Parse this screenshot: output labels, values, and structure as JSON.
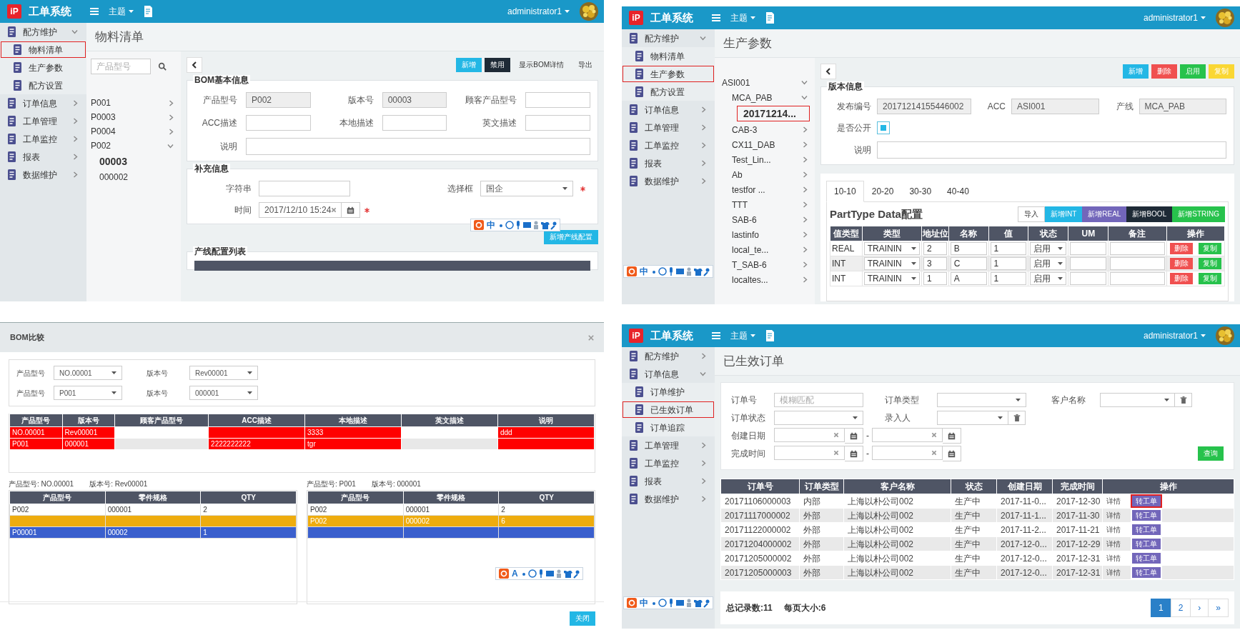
{
  "bom_list": {
    "app": {
      "logo": "iP",
      "title": "工单系统",
      "theme_menu": "主题",
      "user": "administrator1"
    },
    "sidebar": [
      {
        "label": "配方维护",
        "selected": false,
        "expanded": true,
        "children": [
          {
            "label": "物料清单",
            "selected": true
          },
          {
            "label": "生产参数",
            "selected": false
          },
          {
            "label": "配方设置",
            "selected": false
          }
        ]
      },
      {
        "label": "订单信息",
        "selected": false,
        "expanded": false
      },
      {
        "label": "工单管理",
        "selected": false,
        "expanded": false
      },
      {
        "label": "工单监控",
        "selected": false,
        "expanded": false
      },
      {
        "label": "报表",
        "selected": false,
        "expanded": false
      },
      {
        "label": "数据维护",
        "selected": false,
        "expanded": false
      }
    ],
    "page_title": "物料清单",
    "search": {
      "placeholder": "产品型号"
    },
    "tree": [
      {
        "label": "P001",
        "expanded": false
      },
      {
        "label": "P0003",
        "expanded": false
      },
      {
        "label": "P0004",
        "expanded": false
      },
      {
        "label": "P002",
        "expanded": true,
        "children": [
          {
            "label": "00003",
            "selected": true
          },
          {
            "label": "000002",
            "selected": false
          }
        ]
      }
    ],
    "buttons": [
      {
        "label": "新增",
        "kind": "info"
      },
      {
        "label": "禁用",
        "kind": "dark"
      },
      {
        "label": "显示BOM详情",
        "kind": "link"
      },
      {
        "label": "导出",
        "kind": "link"
      }
    ],
    "basic_info": {
      "legend": "BOM基本信息",
      "fields": [
        {
          "label": "产品型号",
          "value": "P002",
          "readonly": true
        },
        {
          "label": "版本号",
          "value": "00003",
          "readonly": true
        },
        {
          "label": "顾客产品型号",
          "readonly": false
        },
        {
          "label": "ACC描述",
          "readonly": false
        },
        {
          "label": "本地描述",
          "readonly": false
        },
        {
          "label": "英文描述",
          "readonly": false
        }
      ],
      "note": {
        "label": "说明"
      }
    },
    "extra_info": {
      "legend": "补充信息",
      "text_field": {
        "label": "字符串"
      },
      "select_field": {
        "label": "选择框",
        "value": "国企",
        "required": true
      },
      "time_field": {
        "label": "时间",
        "value": "2017/12/10 15:24",
        "required": true
      }
    },
    "add_line_button": "新增产线配置",
    "line_config": {
      "legend": "产线配置列表"
    },
    "ime": {
      "mode": "中"
    }
  },
  "production_params": {
    "app": {
      "logo": "iP",
      "title": "工单系统",
      "theme_menu": "主题",
      "user": "administrator1"
    },
    "sidebar": [
      {
        "label": "配方维护",
        "selected": false,
        "expanded": true,
        "children": [
          {
            "label": "物料清单",
            "selected": false
          },
          {
            "label": "生产参数",
            "selected": true
          },
          {
            "label": "配方设置",
            "selected": false
          }
        ]
      },
      {
        "label": "订单信息",
        "selected": false,
        "expanded": false
      },
      {
        "label": "工单管理",
        "selected": false,
        "expanded": false
      },
      {
        "label": "工单监控",
        "selected": false,
        "expanded": false
      },
      {
        "label": "报表",
        "selected": false,
        "expanded": false
      },
      {
        "label": "数据维护",
        "selected": false,
        "expanded": false
      }
    ],
    "page_title": "生产参数",
    "tree": [
      {
        "label": "ASI001",
        "expanded": true,
        "children": [
          {
            "label": "MCA_PAB",
            "expanded": true,
            "children": [
              {
                "label": "20171214...",
                "selected": true,
                "marked": true
              }
            ]
          },
          {
            "label": "CAB-3",
            "expanded": false
          },
          {
            "label": "CX11_DAB",
            "expanded": false
          },
          {
            "label": "Test_Lin...",
            "expanded": false
          },
          {
            "label": "Ab",
            "expanded": false
          },
          {
            "label": "testfor ...",
            "expanded": false
          },
          {
            "label": "TTT",
            "expanded": false
          },
          {
            "label": "SAB-6",
            "expanded": false
          },
          {
            "label": "lastinfo",
            "expanded": false
          },
          {
            "label": "local_te...",
            "expanded": false
          },
          {
            "label": "T_SAB-6",
            "expanded": false
          },
          {
            "label": "localtes...",
            "expanded": false
          }
        ]
      }
    ],
    "buttons": [
      {
        "label": "新增",
        "kind": "info"
      },
      {
        "label": "删除",
        "kind": "danger"
      },
      {
        "label": "启用",
        "kind": "success"
      },
      {
        "label": "复制",
        "kind": "warning"
      }
    ],
    "version_info": {
      "legend": "版本信息",
      "fields": [
        {
          "label": "发布编号",
          "value": "20171214155446002",
          "readonly": true
        },
        {
          "label": "ACC",
          "value": "ASI001",
          "readonly": true
        },
        {
          "label": "产线",
          "value": "MCA_PAB",
          "readonly": true
        }
      ],
      "public": {
        "label": "是否公开",
        "checked": true
      },
      "note": {
        "label": "说明"
      }
    },
    "tabs": [
      {
        "label": "10-10",
        "selected": true
      },
      {
        "label": "20-20",
        "selected": false
      },
      {
        "label": "30-30",
        "selected": false
      },
      {
        "label": "40-40",
        "selected": false
      }
    ],
    "parttype": {
      "title": "PartType Data配置",
      "buttons": [
        {
          "label": "导入",
          "kind": "light"
        },
        {
          "label": "新增INT",
          "kind": "info"
        },
        {
          "label": "新增REAL",
          "kind": "purple"
        },
        {
          "label": "新增BOOL",
          "kind": "dark"
        },
        {
          "label": "新增STRING",
          "kind": "success"
        }
      ],
      "columns": [
        "值类型",
        "类型",
        "地址位",
        "名称",
        "值",
        "状态",
        "UM",
        "备注",
        "操作"
      ],
      "rows": [
        {
          "value_type": "REAL",
          "type": "TRAININ",
          "address": "2",
          "name": "B",
          "value": "1",
          "status": "启用",
          "actions": [
            {
              "label": "删除",
              "kind": "danger"
            },
            {
              "label": "复制",
              "kind": "success"
            }
          ]
        },
        {
          "value_type": "INT",
          "type": "TRAININ",
          "address": "3",
          "name": "C",
          "value": "1",
          "status": "启用",
          "actions": [
            {
              "label": "删除",
              "kind": "danger"
            },
            {
              "label": "复制",
              "kind": "success"
            }
          ]
        },
        {
          "value_type": "INT",
          "type": "TRAININ",
          "address": "1",
          "name": "A",
          "value": "1",
          "status": "启用",
          "actions": [
            {
              "label": "删除",
              "kind": "danger"
            },
            {
              "label": "复制",
              "kind": "success"
            }
          ]
        }
      ]
    },
    "ime": {
      "mode": "中"
    }
  },
  "bom_compare": {
    "title": "BOM比较",
    "filters": [
      {
        "label": "产品型号",
        "value": "NO.00001"
      },
      {
        "label": "版本号",
        "value": "Rev00001"
      },
      {
        "label": "产品型号",
        "value": "P001"
      },
      {
        "label": "版本号",
        "value": "000001"
      }
    ],
    "columns": [
      {
        "label": "产品型号",
        "differs": true
      },
      {
        "label": "版本号",
        "differs": true
      },
      {
        "label": "顾客产品型号",
        "differs": false
      },
      {
        "label": "ACC描述",
        "differs": true
      },
      {
        "label": "本地描述",
        "differs": true
      },
      {
        "label": "英文描述",
        "differs": false
      },
      {
        "label": "说明",
        "differs": true
      }
    ],
    "rows": [
      [
        "NO.00001",
        "Rev00001",
        null,
        null,
        "3333",
        null,
        "ddd"
      ],
      [
        "P001",
        "000001",
        null,
        "2222222222",
        "tgr",
        null,
        null
      ]
    ],
    "parts": [
      {
        "product": "产品型号: NO.00001",
        "version": "版本号: Rev00001",
        "columns": [
          "产品型号",
          "零件规格",
          "QTY"
        ],
        "rows": [
          {
            "cells": [
              "P002",
              "000001",
              "2"
            ]
          },
          {
            "cells": [
              null,
              null,
              null
            ],
            "color": "#eeac0e"
          },
          {
            "cells": [
              "P00001",
              "00002",
              "1"
            ],
            "color": "#3a5fcd"
          }
        ]
      },
      {
        "product": "产品型号: P001",
        "version": "版本号: 000001",
        "columns": [
          "产品型号",
          "零件规格",
          "QTY"
        ],
        "rows": [
          {
            "cells": [
              "P002",
              "000001",
              "2"
            ]
          },
          {
            "cells": [
              "P002",
              "000002",
              "6"
            ],
            "color": "#eeac0e"
          },
          {
            "cells": [
              null,
              null,
              null
            ],
            "color": "#3a5fcd"
          }
        ]
      }
    ],
    "ime": {
      "mode": "A"
    },
    "close_button": "关闭"
  },
  "effective_orders": {
    "app": {
      "logo": "iP",
      "title": "工单系统",
      "theme_menu": "主题",
      "user": "administrator1"
    },
    "sidebar": [
      {
        "label": "配方维护",
        "selected": false,
        "expanded": false
      },
      {
        "label": "订单信息",
        "selected": false,
        "expanded": true,
        "children": [
          {
            "label": "订单维护",
            "selected": false
          },
          {
            "label": "已生效订单",
            "selected": true
          },
          {
            "label": "订单追踪",
            "selected": false
          }
        ]
      },
      {
        "label": "工单管理",
        "selected": false,
        "expanded": false
      },
      {
        "label": "工单监控",
        "selected": false,
        "expanded": false
      },
      {
        "label": "报表",
        "selected": false,
        "expanded": false
      },
      {
        "label": "数据维护",
        "selected": false,
        "expanded": false
      }
    ],
    "page_title": "已生效订单",
    "filters": {
      "order_no": {
        "label": "订单号",
        "placeholder": "模糊匹配"
      },
      "order_type": {
        "label": "订单类型"
      },
      "customer": {
        "label": "客户名称"
      },
      "order_status": {
        "label": "订单状态"
      },
      "entered_by": {
        "label": "录入人"
      },
      "created": {
        "label": "创建日期",
        "separator": "-"
      },
      "finished": {
        "label": "完成时间",
        "separator": "-"
      }
    },
    "query_button": "查询",
    "columns": [
      "订单号",
      "订单类型",
      "客户名称",
      "状态",
      "创建日期",
      "完成时间",
      "操作"
    ],
    "rows": [
      {
        "cells": [
          "20171106000003",
          "内部",
          "上海以朴公司002",
          "生产中",
          "2017-11-0...",
          "2017-12-30"
        ],
        "detail": "详情",
        "convert": "转工单",
        "marked": true
      },
      {
        "cells": [
          "20171117000002",
          "外部",
          "上海以朴公司002",
          "生产中",
          "2017-11-1...",
          "2017-11-30"
        ],
        "detail": "详情",
        "convert": "转工单",
        "marked": false
      },
      {
        "cells": [
          "20171122000002",
          "外部",
          "上海以朴公司002",
          "生产中",
          "2017-11-2...",
          "2017-11-21"
        ],
        "detail": "详情",
        "convert": "转工单",
        "marked": false
      },
      {
        "cells": [
          "20171204000002",
          "外部",
          "上海以朴公司002",
          "生产中",
          "2017-12-0...",
          "2017-12-29"
        ],
        "detail": "详情",
        "convert": "转工单",
        "marked": false
      },
      {
        "cells": [
          "20171205000002",
          "外部",
          "上海以朴公司002",
          "生产中",
          "2017-12-0...",
          "2017-12-31"
        ],
        "detail": "详情",
        "convert": "转工单",
        "marked": false
      },
      {
        "cells": [
          "20171205000003",
          "外部",
          "上海以朴公司002",
          "生产中",
          "2017-12-0...",
          "2017-12-31"
        ],
        "detail": "详情",
        "convert": "转工单",
        "marked": false
      }
    ],
    "total": "总记录数:11",
    "page_size": "每页大小:6",
    "pages": [
      {
        "label": "1",
        "selected": true
      },
      {
        "label": "2",
        "selected": false
      },
      {
        "label": "›",
        "selected": false
      },
      {
        "label": "»",
        "selected": false
      }
    ],
    "ime": {
      "mode": "中"
    }
  }
}
